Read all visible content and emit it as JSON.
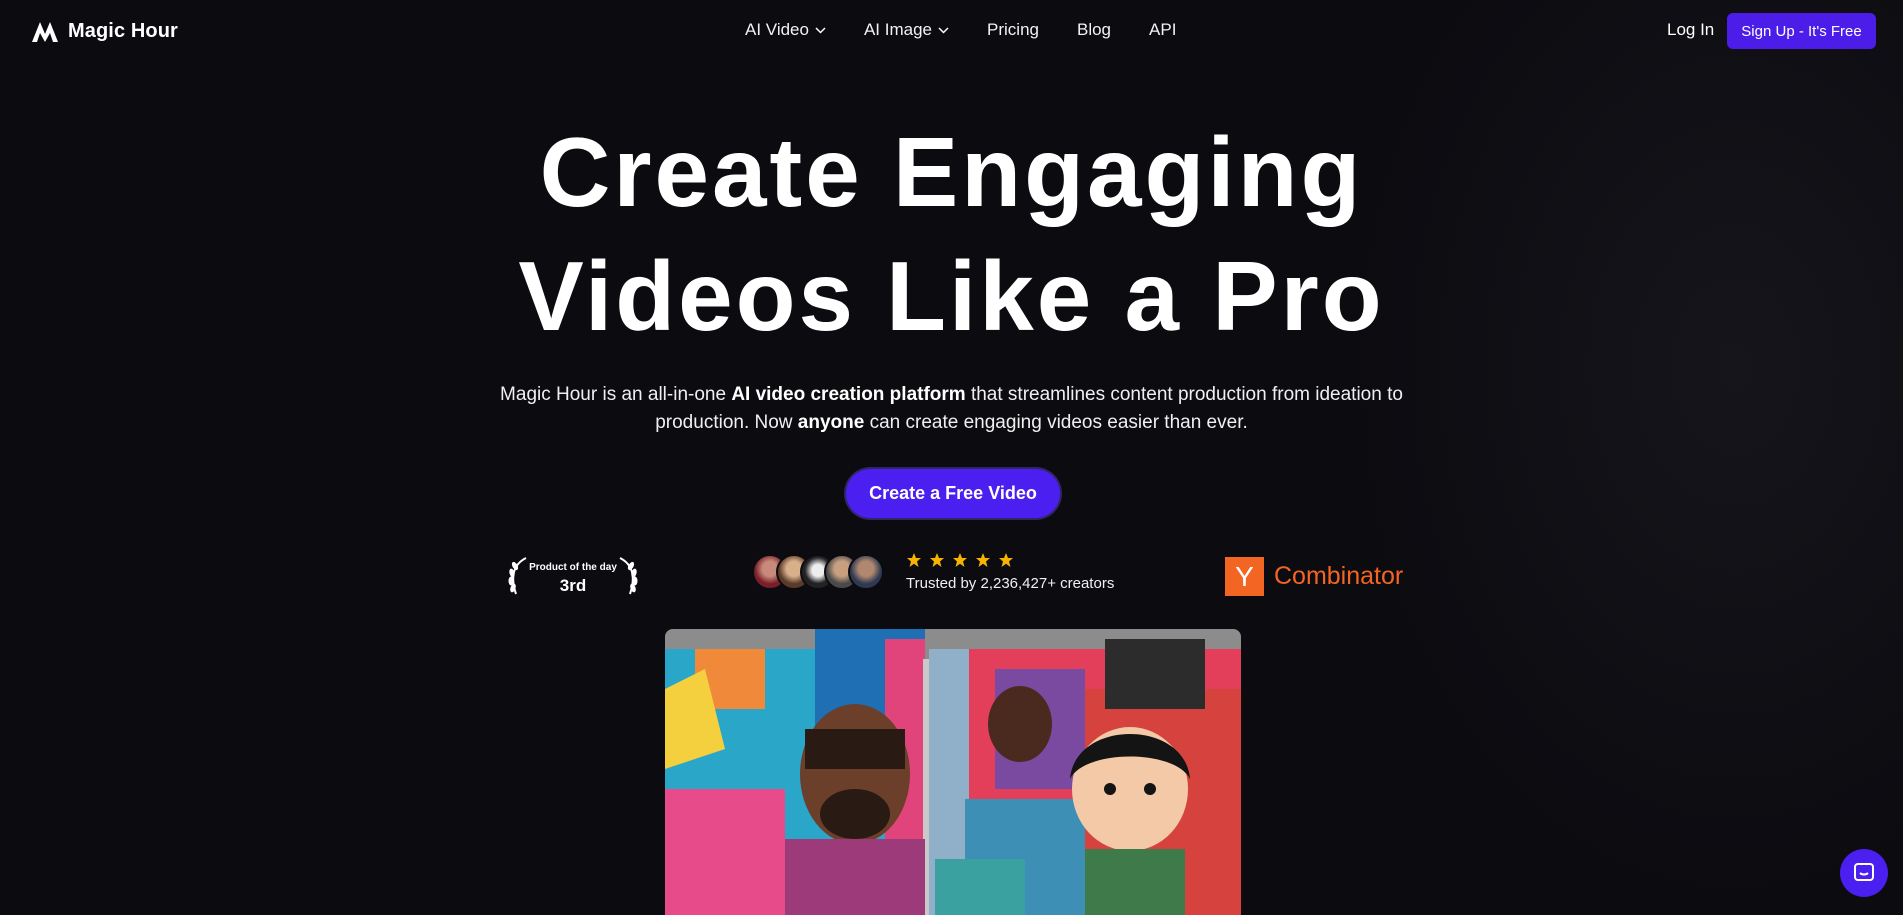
{
  "brand": {
    "name": "Magic Hour"
  },
  "nav": {
    "items": [
      {
        "label": "AI Video",
        "has_dropdown": true
      },
      {
        "label": "AI Image",
        "has_dropdown": true
      },
      {
        "label": "Pricing",
        "has_dropdown": false
      },
      {
        "label": "Blog",
        "has_dropdown": false
      },
      {
        "label": "API",
        "has_dropdown": false
      }
    ],
    "login_label": "Log In",
    "signup_label": "Sign Up  - It's Free"
  },
  "hero": {
    "title_line1": "Create Engaging",
    "title_line2": "Videos Like a Pro",
    "subtitle": {
      "p1": "Magic Hour is an all-in-one ",
      "b1": "AI video creation platform",
      "p2": " that streamlines content production from ideation to production. Now ",
      "b2": "anyone",
      "p3": " can create engaging videos easier than ever."
    },
    "cta_label": "Create a Free Video"
  },
  "social_proof": {
    "product_hunt": {
      "small": "Product of the day",
      "rank": "3rd"
    },
    "rating_stars": 5,
    "trusted_text": "Trusted by 2,236,427+ creators",
    "yc": {
      "letter": "Y",
      "text": "Combinator"
    }
  },
  "colors": {
    "background": "#0b0b10",
    "accent": "#4a1ff0",
    "star": "#f5b400",
    "yc_orange": "#f26522"
  },
  "icons": [
    "magic-hour-logo-icon",
    "chevron-down-icon",
    "laurel-icon",
    "star-icon",
    "chat-icon"
  ]
}
